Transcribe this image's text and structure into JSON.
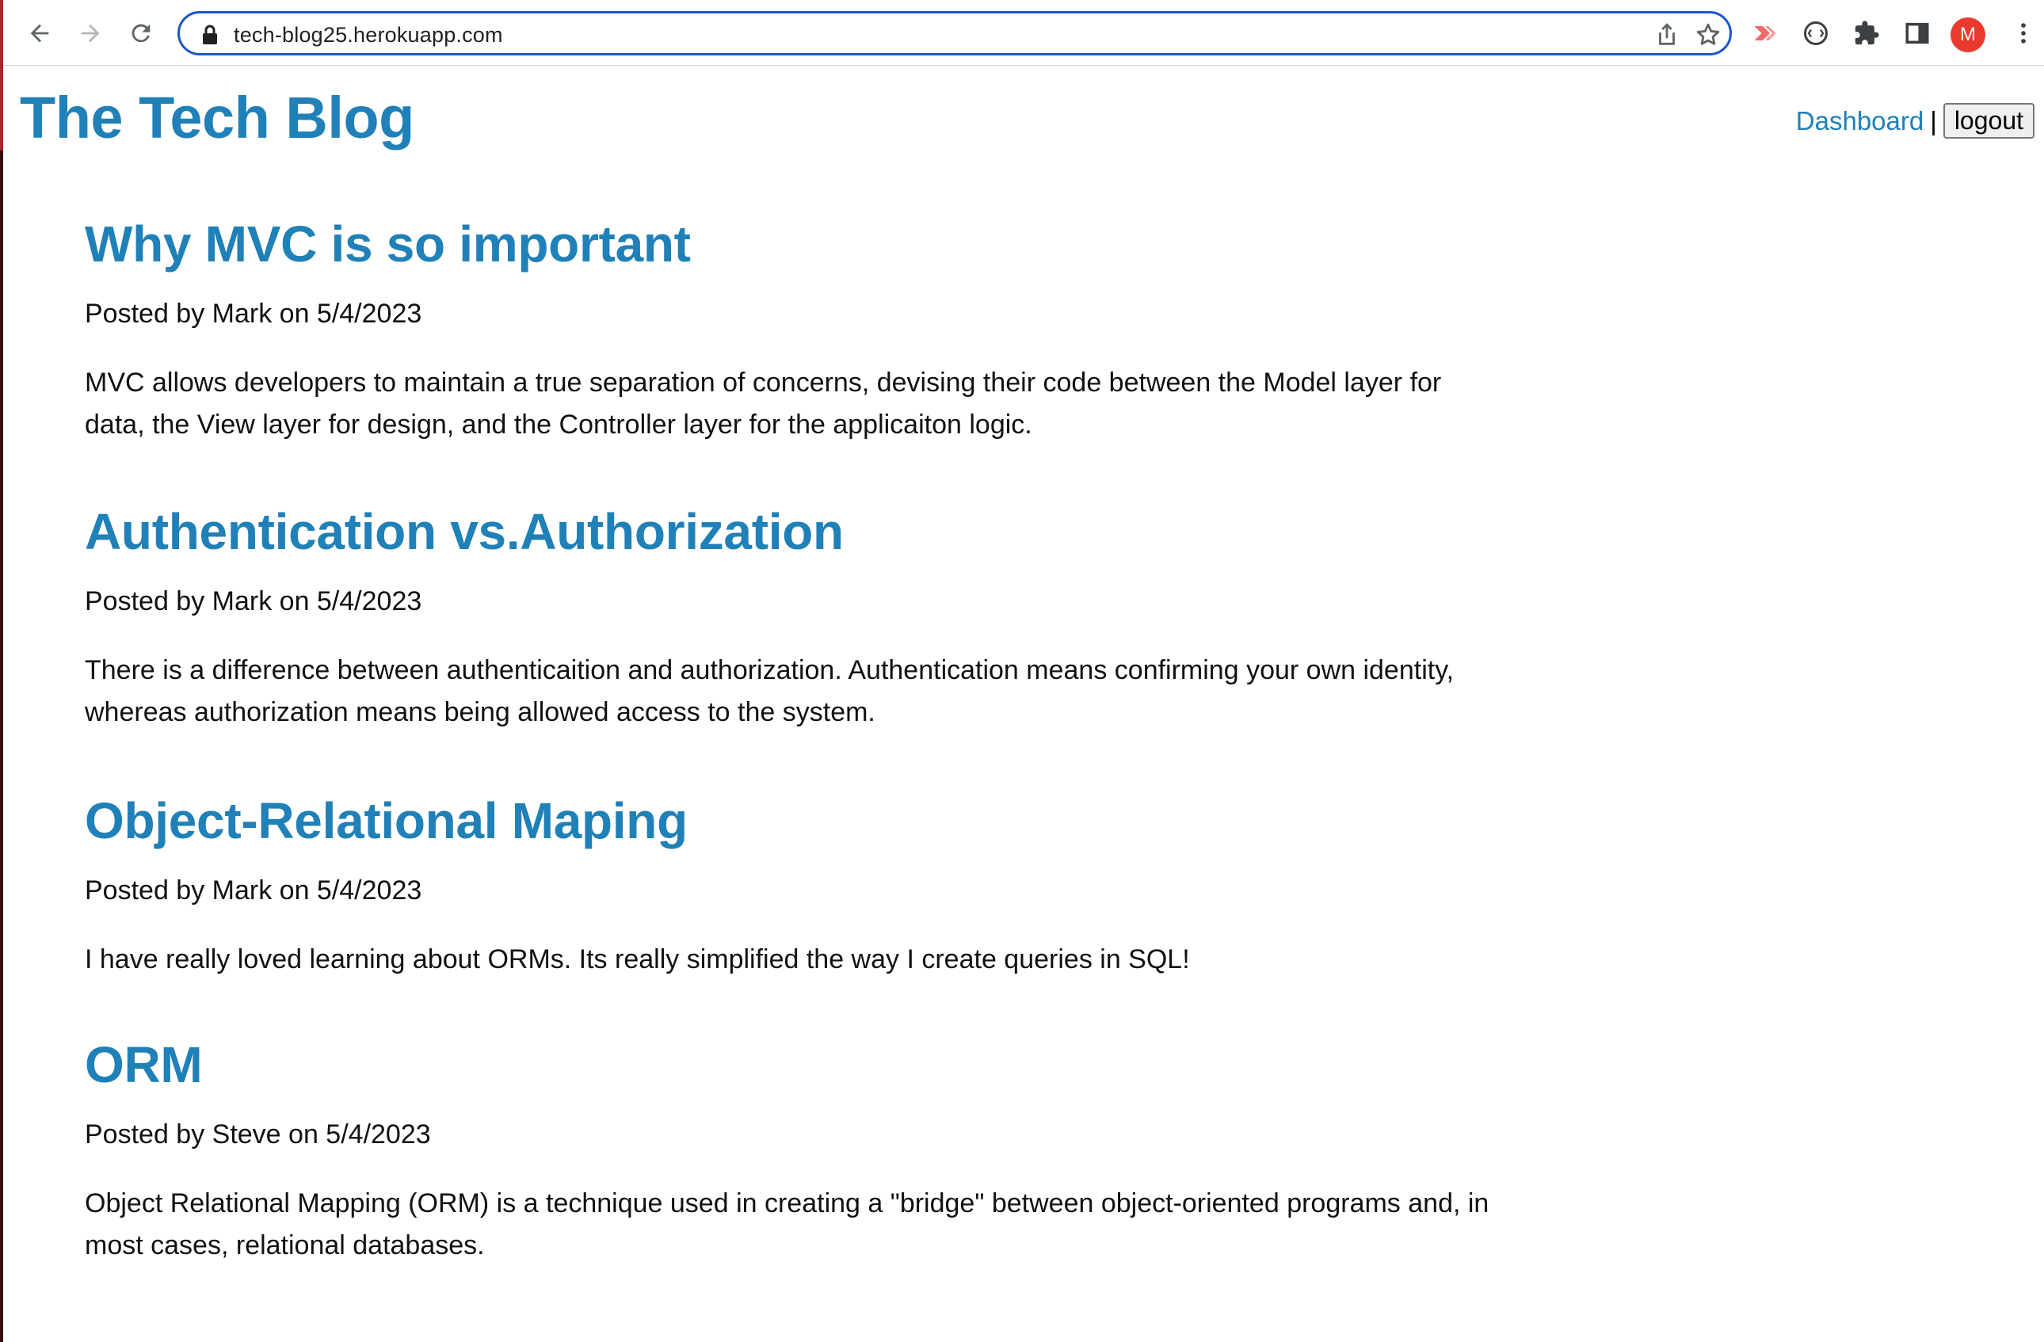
{
  "browser": {
    "url": "tech-blog25.herokuapp.com",
    "profile_initial": "M",
    "icons": [
      "back-arrow-icon",
      "forward-arrow-icon",
      "reload-icon",
      "lock-icon",
      "share-icon",
      "bookmark-star-icon",
      "extension-icon",
      "extensions-puzzle-icon",
      "side-panel-icon",
      "menu-dots-icon"
    ]
  },
  "header": {
    "title": "The Tech Blog",
    "nav": {
      "dashboard_label": "Dashboard",
      "separator": "|",
      "logout_label": "logout"
    }
  },
  "posts": [
    {
      "title": "Why MVC is so important",
      "meta": "Posted by Mark on 5/4/2023",
      "body": "MVC allows developers to maintain a true separation of concerns, devising their code between the Model layer for data, the View layer for design, and the Controller layer for the applicaiton logic."
    },
    {
      "title": "Authentication vs.Authorization",
      "meta": "Posted by Mark on 5/4/2023",
      "body": "There is a difference between authenticaition and authorization. Authentication means confirming your own identity, whereas authorization means being allowed access to the system."
    },
    {
      "title": "Object-Relational Maping",
      "meta": "Posted by Mark on 5/4/2023",
      "body": "I have really loved learning about ORMs. Its really simplified the way I create queries in SQL!"
    },
    {
      "title": "ORM",
      "meta": "Posted by Steve on 5/4/2023",
      "body": "Object Relational Mapping (ORM) is a technique used in creating a \"bridge\" between object-oriented programs and, in most cases, relational databases."
    }
  ],
  "colors": {
    "accent": "#2080b8",
    "omnibox_focus": "#1a56c6",
    "avatar_bg": "#ea3a2d"
  }
}
